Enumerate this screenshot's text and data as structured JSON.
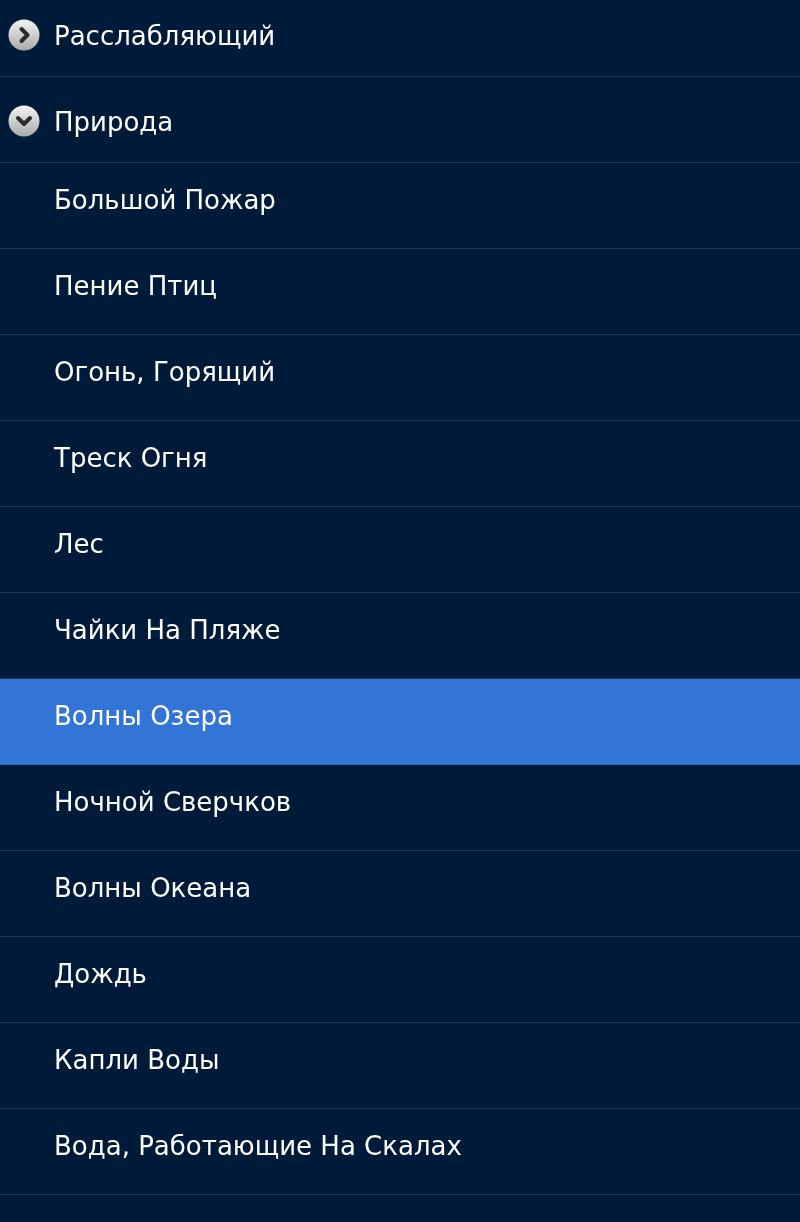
{
  "list": {
    "groups": [
      {
        "label": "Расслабляющий",
        "expanded": false
      },
      {
        "label": "Природа",
        "expanded": true,
        "children": [
          {
            "label": "Большой Пожар",
            "selected": false
          },
          {
            "label": "Пение Птиц",
            "selected": false
          },
          {
            "label": "Огонь, Горящий",
            "selected": false
          },
          {
            "label": "Треск Огня",
            "selected": false
          },
          {
            "label": "Лес",
            "selected": false
          },
          {
            "label": "Чайки На Пляже",
            "selected": false
          },
          {
            "label": "Волны Озера",
            "selected": true
          },
          {
            "label": "Ночной Сверчков",
            "selected": false
          },
          {
            "label": "Волны Океана",
            "selected": false
          },
          {
            "label": "Дождь",
            "selected": false
          },
          {
            "label": "Капли Воды",
            "selected": false
          },
          {
            "label": "Вода, Работающие На Скалах",
            "selected": false
          }
        ]
      }
    ]
  }
}
